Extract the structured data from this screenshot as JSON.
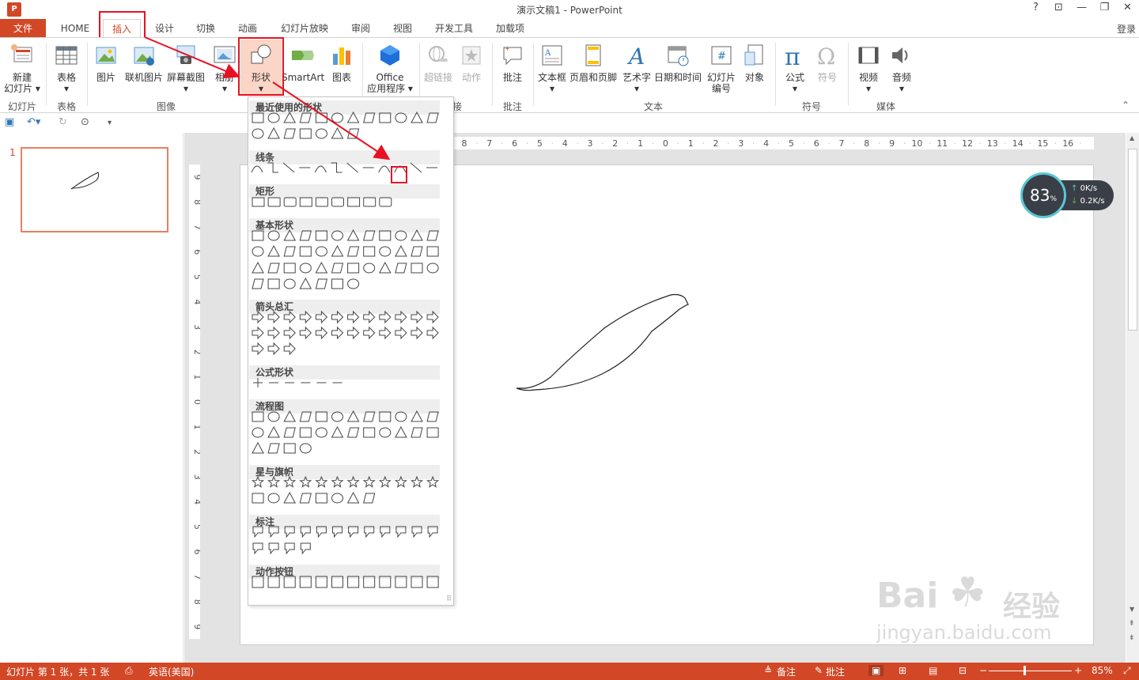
{
  "window": {
    "title": "演示文稿1 - PowerPoint",
    "controls": [
      "?",
      "⊡",
      "—",
      "❐",
      "✕"
    ]
  },
  "tabs": [
    {
      "label": "文件"
    },
    {
      "label": "HOME"
    },
    {
      "label": "插入"
    },
    {
      "label": "设计"
    },
    {
      "label": "切换"
    },
    {
      "label": "动画"
    },
    {
      "label": "幻灯片放映"
    },
    {
      "label": "审阅"
    },
    {
      "label": "视图"
    },
    {
      "label": "开发工具"
    },
    {
      "label": "加载项"
    }
  ],
  "signin": "登录",
  "ribbon": {
    "buttons": [
      {
        "label": "新建",
        "label2": "幻灯片 ▾",
        "icon": "new-slide-icon"
      },
      {
        "label": "表格",
        "label2": "▾",
        "icon": "table-icon"
      },
      {
        "label": "图片",
        "icon": "picture-icon"
      },
      {
        "label": "联机图片",
        "icon": "online-picture-icon"
      },
      {
        "label": "屏幕截图",
        "label2": "▾",
        "icon": "screenshot-icon"
      },
      {
        "label": "相册",
        "label2": "▾",
        "icon": "album-icon"
      },
      {
        "label": "形状",
        "label2": "▾",
        "icon": "shapes-icon"
      },
      {
        "label": "SmartArt",
        "icon": "smartart-icon"
      },
      {
        "label": "图表",
        "icon": "chart-icon"
      },
      {
        "label": "Office",
        "label2": "应用程序 ▾",
        "icon": "office-apps-icon"
      },
      {
        "label": "超链接",
        "icon": "hyperlink-icon"
      },
      {
        "label": "动作",
        "icon": "action-icon"
      },
      {
        "label": "批注",
        "icon": "comment-icon"
      },
      {
        "label": "文本框",
        "label2": "▾",
        "icon": "textbox-icon"
      },
      {
        "label": "页眉和页脚",
        "icon": "header-footer-icon"
      },
      {
        "label": "艺术字",
        "label2": "▾",
        "icon": "wordart-icon"
      },
      {
        "label": "日期和时间",
        "icon": "datetime-icon"
      },
      {
        "label": "幻灯片",
        "label2": "编号",
        "icon": "slide-number-icon"
      },
      {
        "label": "对象",
        "icon": "object-icon"
      },
      {
        "label": "公式",
        "label2": "▾",
        "icon": "equation-icon"
      },
      {
        "label": "符号",
        "icon": "symbol-icon"
      },
      {
        "label": "视频",
        "label2": "▾",
        "icon": "video-icon"
      },
      {
        "label": "音频",
        "label2": "▾",
        "icon": "audio-icon"
      }
    ],
    "groups": [
      "幻灯片",
      "表格",
      "图像",
      "接",
      "批注",
      "文本",
      "符号",
      "媒体"
    ]
  },
  "shapes_menu": {
    "sections": [
      "最近使用的形状",
      "线条",
      "矩形",
      "基本形状",
      "箭头总汇",
      "公式形状",
      "流程图",
      "星与旗帜",
      "标注",
      "动作按钮"
    ]
  },
  "thumbnail": {
    "number": "1"
  },
  "speed_widget": {
    "percent": "83",
    "percent_sign": "%",
    "up": "0K/s",
    "down": "0.2K/s"
  },
  "ruler": {
    "h_ticks": [
      "8",
      "7",
      "6",
      "5",
      "4",
      "3",
      "2",
      "1",
      "0",
      "1",
      "2",
      "3",
      "4",
      "5",
      "6",
      "7",
      "8",
      "9",
      "10",
      "11",
      "12",
      "13",
      "14",
      "15",
      "16"
    ],
    "v_ticks": [
      "9",
      "8",
      "7",
      "6",
      "5",
      "4",
      "3",
      "2",
      "1",
      "0",
      "1",
      "2",
      "3",
      "4",
      "5",
      "6",
      "7",
      "8",
      "9"
    ]
  },
  "statusbar": {
    "slide_info": "幻灯片 第 1 张，共 1 张",
    "language": "英语(美国)",
    "notes": "备注",
    "comments": "批注",
    "zoom": "85%"
  },
  "watermark": {
    "brand": "Bai",
    "brand2": "经验",
    "url": "jingyan.baidu.com"
  },
  "colors": {
    "accent": "#d24726",
    "highlight": "#e81123"
  }
}
